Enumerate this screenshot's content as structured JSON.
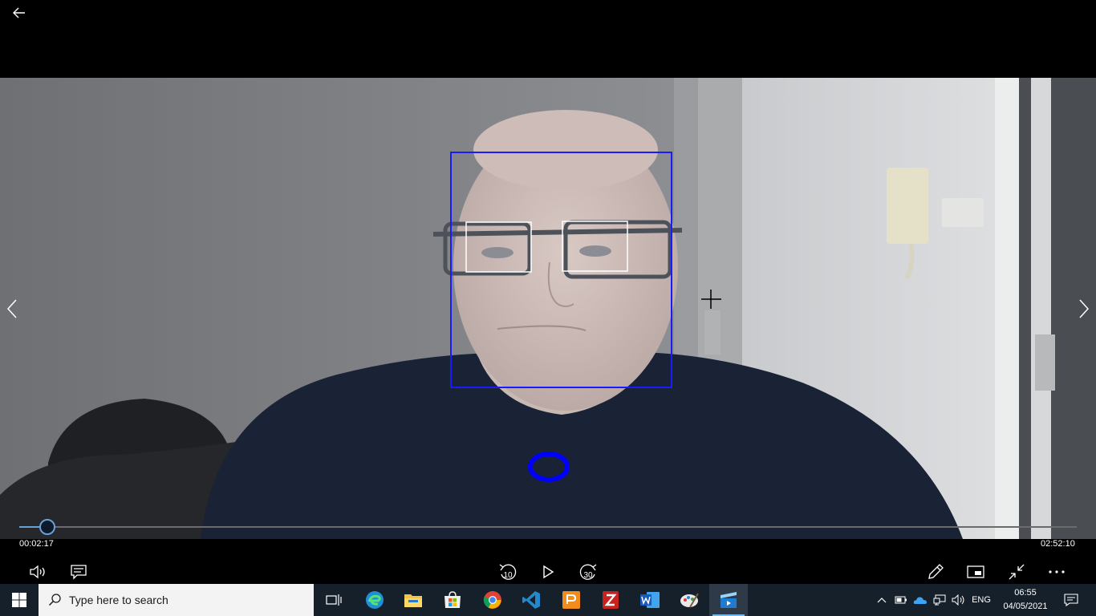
{
  "player": {
    "back_icon": "back-arrow-icon",
    "prev_icon": "chevron-left-icon",
    "next_icon": "chevron-right-icon",
    "progress": 0.0132,
    "elapsed": "00:02:17",
    "total": "02:52:10",
    "accent_color": "#6aa0d8",
    "controls": {
      "volume_icon": "volume-icon",
      "captions_icon": "captions-icon",
      "skip_back_label": "10",
      "play_icon": "play-icon",
      "skip_forward_label": "30",
      "edit_icon": "pencil-icon",
      "miniview_icon": "mini-view-icon",
      "fullscreen_icon": "exit-fullscreen-icon",
      "more_icon": "more-options-icon"
    }
  },
  "video_overlay": {
    "face_box_color": "#1a1aff",
    "eye_box_color": "#ffffff",
    "marker_color": "#0000ff"
  },
  "taskbar": {
    "search_placeholder": "Type here to search",
    "apps": [
      "task-view",
      "edge",
      "file-explorer",
      "microsoft-store",
      "chrome",
      "vscode",
      "pdf-app",
      "zotero",
      "word",
      "paint",
      "movies-tv"
    ],
    "tray": {
      "language": "ENG",
      "time": "06:55",
      "date": "04/05/2021"
    }
  }
}
